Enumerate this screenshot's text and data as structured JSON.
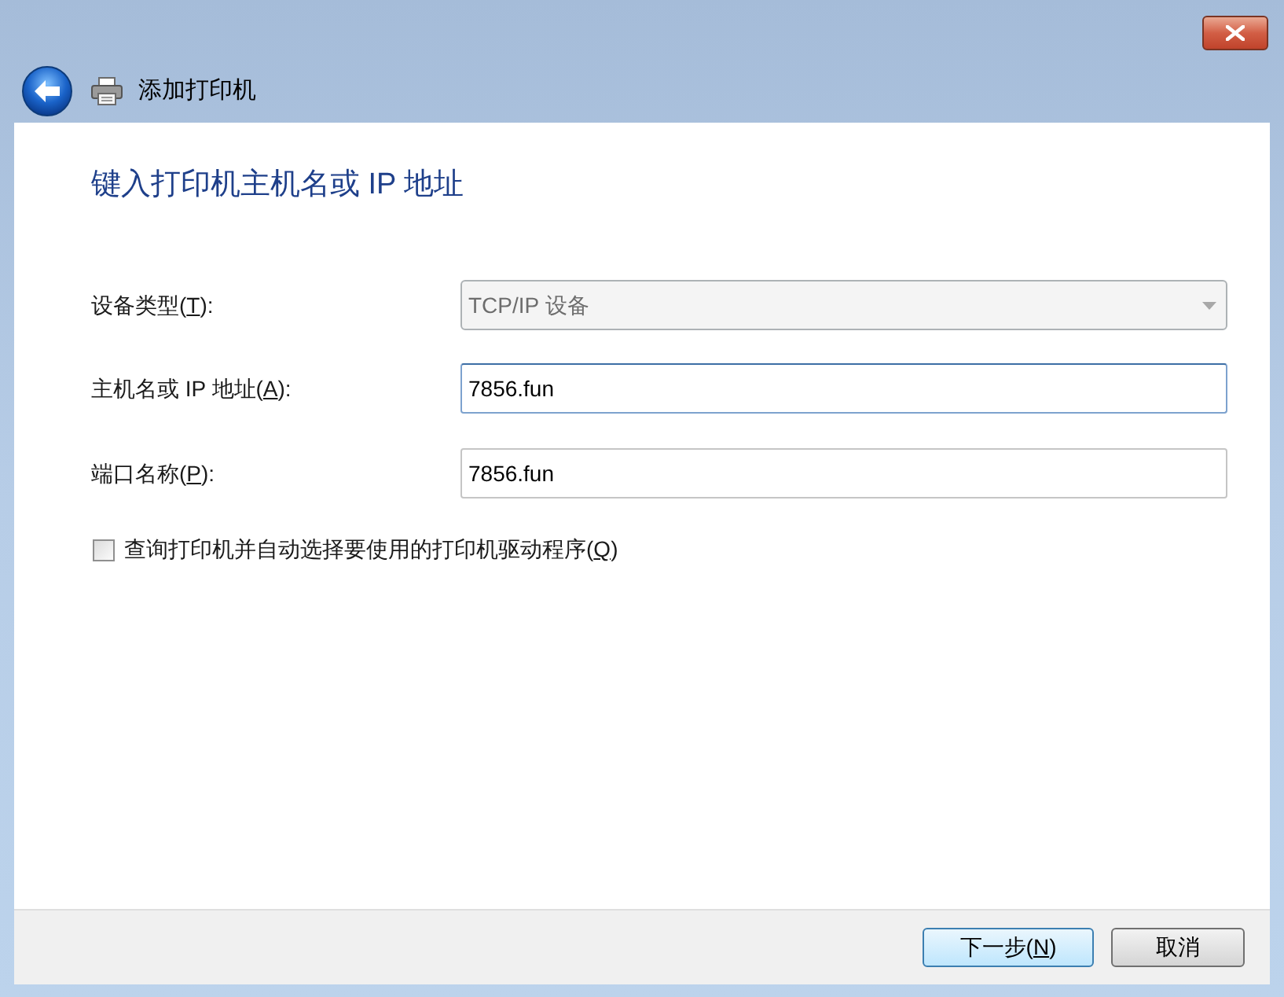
{
  "window": {
    "title": "添加打印机"
  },
  "heading": "键入打印机主机名或 IP 地址",
  "fields": [
    {
      "kind": "dropdown",
      "label_before": "设备类型(",
      "mnemonic": "T",
      "label_after": "):",
      "value": "TCP/IP 设备",
      "disabled": true,
      "focused": false
    },
    {
      "kind": "text",
      "label_before": "主机名或 IP 地址(",
      "mnemonic": "A",
      "label_after": "):",
      "value": "7856.fun",
      "disabled": false,
      "focused": true
    },
    {
      "kind": "text",
      "label_before": "端口名称(",
      "mnemonic": "P",
      "label_after": "):",
      "value": "7856.fun",
      "disabled": false,
      "focused": false
    }
  ],
  "checkbox": {
    "label_before": "查询打印机并自动选择要使用的打印机驱动程序(",
    "mnemonic": "Q",
    "label_after": ")",
    "checked": false
  },
  "buttons": [
    {
      "label_before": "下一步(",
      "mnemonic": "N",
      "label_after": ")",
      "default": true
    },
    {
      "label_before": "取消",
      "default": false
    }
  ]
}
